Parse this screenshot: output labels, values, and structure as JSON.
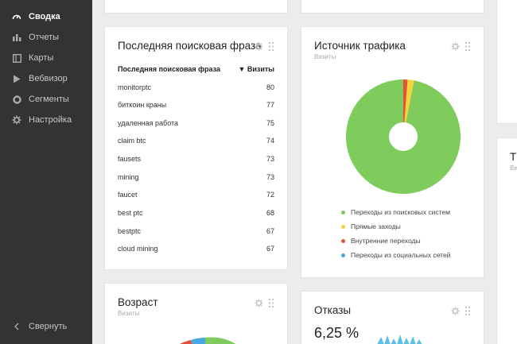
{
  "sidebar": {
    "items": [
      {
        "label": "Сводка",
        "icon": "dashboard-icon",
        "active": true
      },
      {
        "label": "Отчеты",
        "icon": "bar-chart-icon",
        "active": false
      },
      {
        "label": "Карты",
        "icon": "map-icon",
        "active": false
      },
      {
        "label": "Вебвизор",
        "icon": "play-icon",
        "active": false
      },
      {
        "label": "Сегменты",
        "icon": "segments-icon",
        "active": false
      },
      {
        "label": "Настройка",
        "icon": "gear-icon",
        "active": false
      }
    ],
    "collapse_label": "Свернуть"
  },
  "search_phrase": {
    "title": "Последняя поисковая фраза",
    "col_phrase": "Последняя поисковая фраза",
    "col_visits": "▼ Визиты",
    "rows": [
      {
        "phrase": "monitorptc",
        "visits": "80"
      },
      {
        "phrase": "биткоин краны",
        "visits": "77"
      },
      {
        "phrase": "удаленная работа",
        "visits": "75"
      },
      {
        "phrase": "claim btc",
        "visits": "74"
      },
      {
        "phrase": "fausets",
        "visits": "73"
      },
      {
        "phrase": "mining",
        "visits": "73"
      },
      {
        "phrase": "faucet",
        "visits": "72"
      },
      {
        "phrase": "best ptc",
        "visits": "68"
      },
      {
        "phrase": "bestptc",
        "visits": "67"
      },
      {
        "phrase": "cloud mining",
        "visits": "67"
      }
    ]
  },
  "traffic": {
    "title": "Источник трафика",
    "subtitle": "Визиты",
    "legend": [
      {
        "label": "Переходы из поисковых систем",
        "color": "#7fcc5c"
      },
      {
        "label": "Прямые заходы",
        "color": "#f5d437"
      },
      {
        "label": "Внутренние переходы",
        "color": "#e4523b"
      },
      {
        "label": "Переходы из социальных сетей",
        "color": "#46a8e0"
      }
    ]
  },
  "chart_data": {
    "type": "pie",
    "title": "Источник трафика",
    "subtitle": "Визиты",
    "categories": [
      "Переходы из поисковых систем",
      "Прямые заходы",
      "Внутренние переходы",
      "Переходы из социальных сетей"
    ],
    "values": [
      97,
      1.8,
      1.2,
      0
    ],
    "colors": [
      "#7fcc5c",
      "#f5d437",
      "#e4523b",
      "#46a8e0"
    ]
  },
  "age": {
    "title": "Возраст",
    "subtitle": "Визиты"
  },
  "bounce": {
    "title": "Отказы",
    "value": "6,25 %"
  },
  "right_card": {
    "title": "Т",
    "subtitle": "Визи"
  }
}
